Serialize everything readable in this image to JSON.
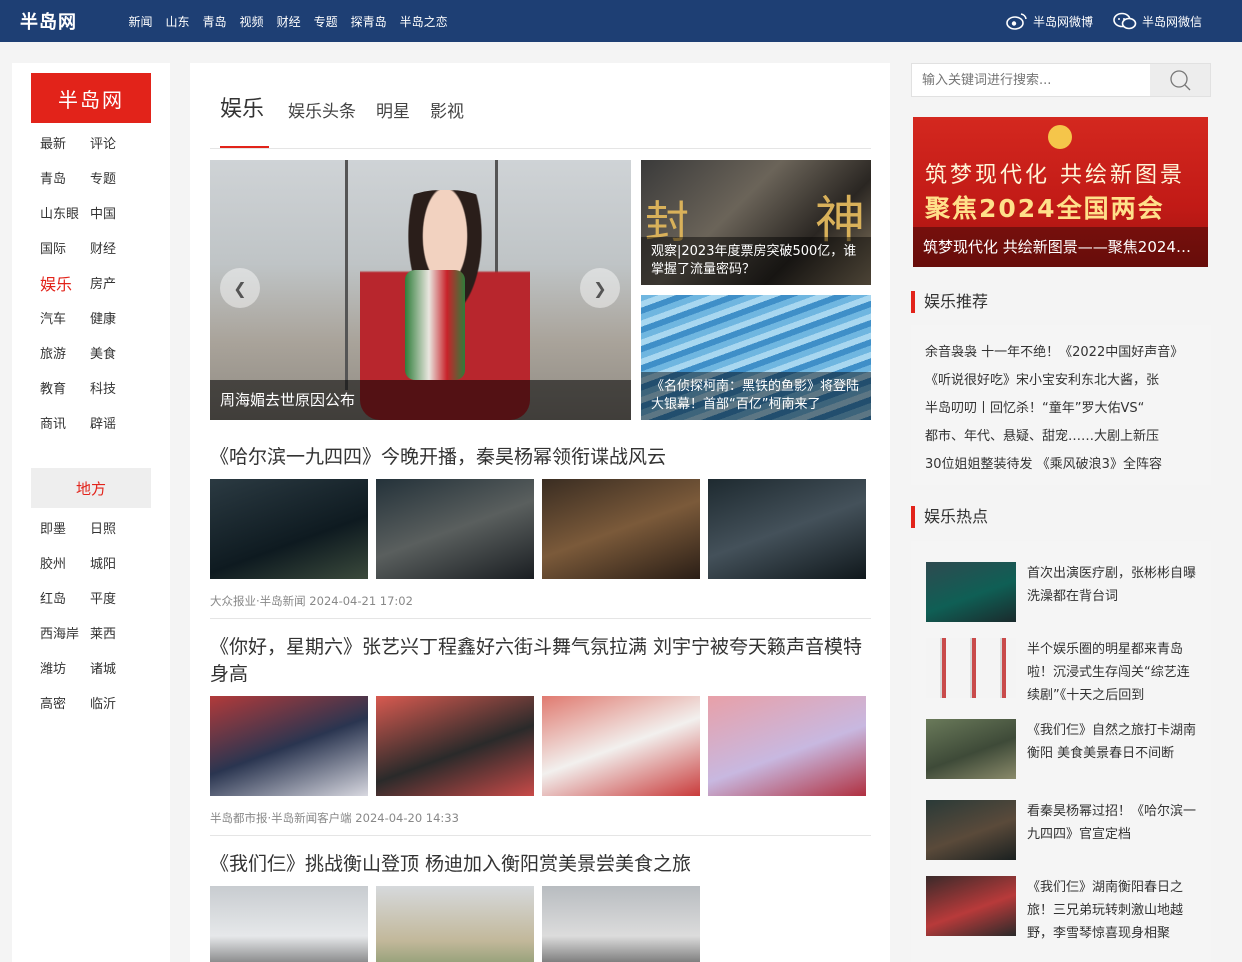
{
  "header": {
    "logo": "半岛网",
    "nav": [
      "新闻",
      "山东",
      "青岛",
      "视频",
      "财经",
      "专题",
      "探青岛",
      "半岛之恋"
    ],
    "weibo": "半岛网微博",
    "weixin": "半岛网微信"
  },
  "sidebar": {
    "brand": "半岛网",
    "items": [
      "最新",
      "评论",
      "青岛",
      "专题",
      "山东眼",
      "中国",
      "国际",
      "财经",
      "娱乐",
      "房产",
      "汽车",
      "健康",
      "旅游",
      "美食",
      "教育",
      "科技",
      "商讯",
      "辟谣"
    ],
    "active": "娱乐",
    "region_title": "地方",
    "regions": [
      "即墨",
      "日照",
      "胶州",
      "城阳",
      "红岛",
      "平度",
      "西海岸",
      "莱西",
      "潍坊",
      "诸城",
      "高密",
      "临沂"
    ]
  },
  "channel": {
    "title": "娱乐",
    "subtabs": [
      "娱乐头条",
      "明星",
      "影视"
    ]
  },
  "slider": {
    "caption": "周海媚去世原因公布",
    "prev_icon": "chevron-left-icon",
    "next_icon": "chevron-right-icon"
  },
  "side_pics": [
    {
      "caption": "观察|2023年度票房突破500亿，谁掌握了流量密码？",
      "art_left": "封",
      "art_right": "神"
    },
    {
      "caption": "《名侦探柯南：黑铁的鱼影》将登陆大银幕！首部“百亿”柯南来了"
    }
  ],
  "articles": [
    {
      "title": "《哈尔滨一九四四》今晚开播，秦昊杨幂领衔谍战风云",
      "meta": "大众报业·半岛新闻 2024-04-21 17:02"
    },
    {
      "title": "《你好，星期六》张艺兴丁程鑫好六街斗舞气氛拉满 刘宇宁被夸天籁声音模特身高",
      "meta": "半岛都市报·半岛新闻客户端 2024-04-20 14:33"
    },
    {
      "title": "《我们仨》挑战衡山登顶 杨迪加入衡阳赏美景尝美食之旅",
      "meta": ""
    }
  ],
  "search": {
    "placeholder": "输入关键词进行搜索..."
  },
  "banner": {
    "line1": "筑梦现代化 共绘新图景",
    "line2": "聚焦2024全国两会",
    "caption": "筑梦现代化 共绘新图景——聚焦2024全国两会"
  },
  "recommend": {
    "title": "娱乐推荐",
    "items": [
      "余音袅袅 十一年不绝！《2022中国好声音》",
      "《听说很好吃》宋小宝安利东北大酱，张",
      "半岛叨叨丨回忆杀！“童年”罗大佑VS“",
      "都市、年代、悬疑、甜宠……大剧上新压",
      "30位姐姐整装待发 《乘风破浪3》全阵容"
    ]
  },
  "hot": {
    "title": "娱乐热点",
    "items": [
      "首次出演医疗剧，张彬彬自曝洗澡都在背台词",
      "半个娱乐圈的明星都来青岛啦！沉浸式生存闯关“综艺连续剧”《十天之后回到",
      "《我们仨》自然之旅打卡湖南衡阳 美食美景春日不间断",
      "看秦昊杨幂过招！《哈尔滨一九四四》官宣定档",
      "《我们仨》湖南衡阳春日之旅！三兄弟玩转刺激山地越野，李雪琴惊喜现身相聚"
    ]
  },
  "colors": {
    "topbar": "#1e3f74",
    "accent": "#e2231a"
  }
}
